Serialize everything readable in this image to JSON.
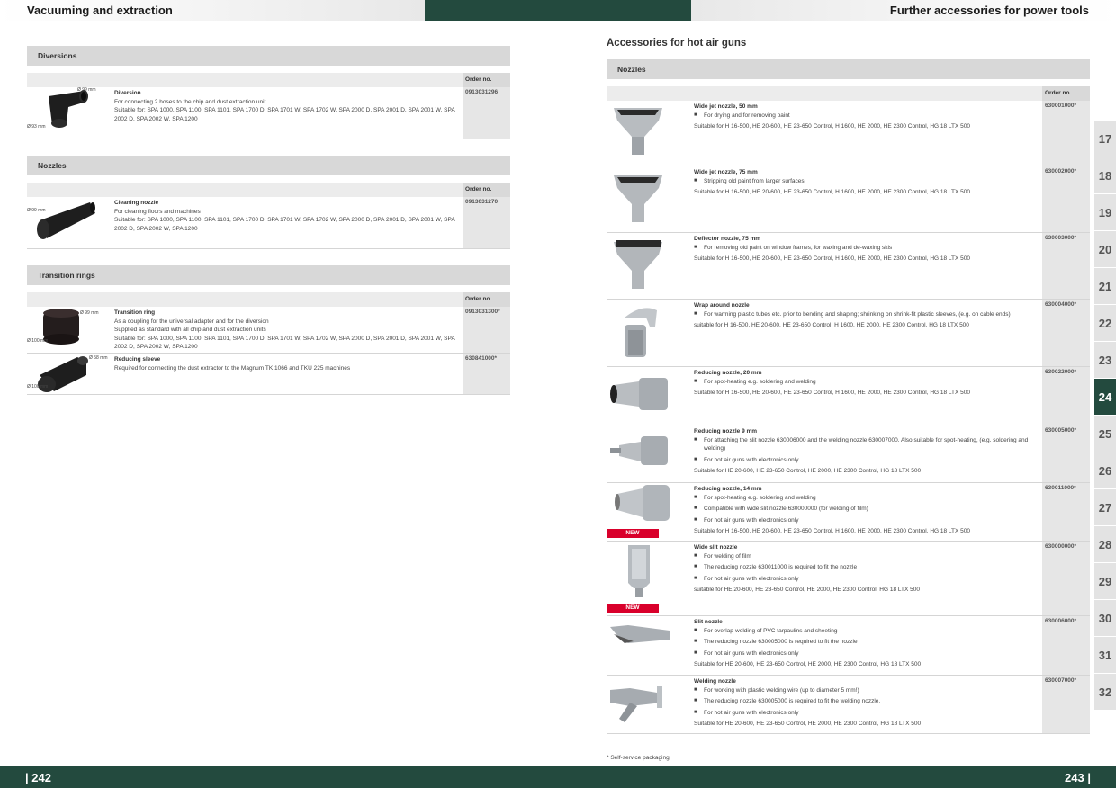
{
  "header": {
    "left_title": "Vacuuming and extraction",
    "right_title": "Further accessories for power tools"
  },
  "footer": {
    "left_page": "| 242",
    "right_page": "243 |"
  },
  "left": {
    "order_label": "Order no.",
    "sections": [
      {
        "title": "Diversions",
        "products": [
          {
            "name": "Diversion",
            "lines": [
              "For connecting 2 hoses to the chip and dust extraction unit",
              "Suitable for: SPA 1000, SPA 1100, SPA 1101, SPA 1700 D, SPA 1701 W, SPA 1702 W, SPA 2000 D, SPA 2001 D, SPA 2001 W, SPA 2002 D, SPA 2002 W, SPA 1200"
            ],
            "order": "0913031296",
            "dims": [
              "Ø 99 mm",
              "Ø 93 mm"
            ]
          }
        ]
      },
      {
        "title": "Nozzles",
        "products": [
          {
            "name": "Cleaning nozzle",
            "lines": [
              "For cleaning floors and machines",
              "Suitable for: SPA 1000, SPA 1100, SPA 1101, SPA 1700 D, SPA 1701 W, SPA 1702 W, SPA 2000 D, SPA 2001 D, SPA 2001 W, SPA 2002 D, SPA 2002 W, SPA 1200"
            ],
            "order": "0913031270",
            "dims": [
              "Ø 99 mm"
            ]
          }
        ]
      },
      {
        "title": "Transition rings",
        "products": [
          {
            "name": "Transition ring",
            "lines": [
              "As a coupling for the universal adapter and for the diversion",
              "Supplied as standard with all chip and dust extraction units",
              "Suitable for: SPA 1000, SPA 1100, SPA 1101, SPA 1700 D, SPA 1701 W, SPA 1702 W, SPA 2000 D, SPA 2001 D, SPA 2001 W, SPA 2002 D, SPA 2002 W, SPA 1200"
            ],
            "order": "0913031300*",
            "dims": [
              "Ø 99 mm",
              "Ø 100 mm"
            ]
          },
          {
            "name": "Reducing sleeve",
            "lines": [
              "Required for connecting the dust extractor to the Magnum TK 1066 and TKU 225 machines"
            ],
            "order": "630841000*",
            "dims": [
              "Ø 58 mm",
              "Ø 100 mm"
            ]
          }
        ]
      }
    ]
  },
  "right": {
    "heading": "Accessories for hot air guns",
    "section_title": "Nozzles",
    "order_label": "Order no.",
    "new_label": "NEW",
    "footnote": "* Self-service packaging",
    "products": [
      {
        "name": "Wide jet nozzle, 50 mm",
        "bullets": [
          "For drying and for removing paint"
        ],
        "suitable": "Suitable for H 16-500, HE 20-600, HE 23-650 Control, H 1600, HE 2000, HE 2300 Control, HG 18 LTX 500",
        "order": "630001000*"
      },
      {
        "name": "Wide jet nozzle, 75 mm",
        "bullets": [
          "Stripping old paint from larger surfaces"
        ],
        "suitable": "Suitable for H 16-500, HE 20-600, HE 23-650 Control, H 1600, HE 2000, HE 2300 Control, HG 18 LTX 500",
        "order": "630002000*"
      },
      {
        "name": "Deflector nozzle, 75 mm",
        "bullets": [
          "For removing old paint on window frames, for waxing and de-waxing skis"
        ],
        "suitable": "Suitable for H 16-500, HE 20-600, HE 23-650 Control, H 1600, HE 2000, HE 2300 Control, HG 18 LTX 500",
        "order": "630003000*"
      },
      {
        "name": "Wrap around nozzle",
        "bullets": [
          "For warming plastic tubes etc. prior to bending and shaping; shrinking on shrink-fit plastic sleeves, (e.g. on cable ends)"
        ],
        "suitable": "suitable for H 16-500, HE 20-600, HE 23-650 Control, H 1600, HE 2000, HE 2300 Control, HG 18 LTX 500",
        "order": "630004000*"
      },
      {
        "name": "Reducing nozzle, 20 mm",
        "bullets": [
          "For spot-heating e.g. soldering and welding"
        ],
        "suitable": "Suitable for H 16-500, HE 20-600, HE 23-650 Control, H 1600, HE 2000, HE 2300 Control, HG 18 LTX 500",
        "order": "630022000*"
      },
      {
        "name": "Reducing nozzle 9 mm",
        "bullets": [
          "For attaching the slit nozzle 630006000 and the welding nozzle 630007000. Also suitable for spot-heating, (e.g. soldering and welding)",
          "For hot air guns with electronics only"
        ],
        "suitable": "Suitable for HE 20-600, HE 23-650 Control, HE 2000, HE 2300 Control, HG 18 LTX 500",
        "order": "630005000*"
      },
      {
        "name": "Reducing nozzle, 14 mm",
        "bullets": [
          "For spot-heating e.g. soldering and welding",
          "Compatible with wide slit nozzle 630000000 (for welding of film)",
          "For hot air guns with electronics only"
        ],
        "suitable": "Suitable for H 16-500, HE 20-600, HE 23-650 Control, H 1600, HE 2000, HE 2300 Control, HG 18 LTX 500",
        "order": "630011000*"
      },
      {
        "name": "Wide slit nozzle",
        "bullets": [
          "For welding of film",
          "The reducing nozzle 630011000 is required to fit the nozzle",
          "For hot air guns with electronics only"
        ],
        "suitable": "suitable for HE 20-600, HE 23-650 Control, HE 2000, HE 2300 Control, HG 18 LTX 500",
        "order": "630000000*"
      },
      {
        "name": "Slit nozzle",
        "bullets": [
          "For overlap-welding of PVC tarpaulins and sheeting",
          "The reducing nozzle 630005000 is required to fit the nozzle",
          "For hot air guns with electronics only"
        ],
        "suitable": "Suitable for HE 20-600, HE 23-650 Control, HE 2000, HE 2300 Control, HG 18 LTX 500",
        "order": "630006000*"
      },
      {
        "name": "Welding nozzle",
        "bullets": [
          "For working with plastic welding wire (up to diameter 5 mm!)",
          "The reducing nozzle 630005000 is required to fit the welding nozzle.",
          "For hot air guns with electronics only"
        ],
        "suitable": "Suitable for HE 20-600, HE 23-650 Control, HE 2000, HE 2300 Control, HG 18 LTX 500",
        "order": "630007000*"
      }
    ]
  },
  "tabs": [
    "17",
    "18",
    "19",
    "20",
    "21",
    "22",
    "23",
    "24",
    "25",
    "26",
    "27",
    "28",
    "29",
    "30",
    "31",
    "32"
  ],
  "active_tab": "24",
  "colors": {
    "brand_green": "#234a3e",
    "new_badge": "#d9002b"
  }
}
